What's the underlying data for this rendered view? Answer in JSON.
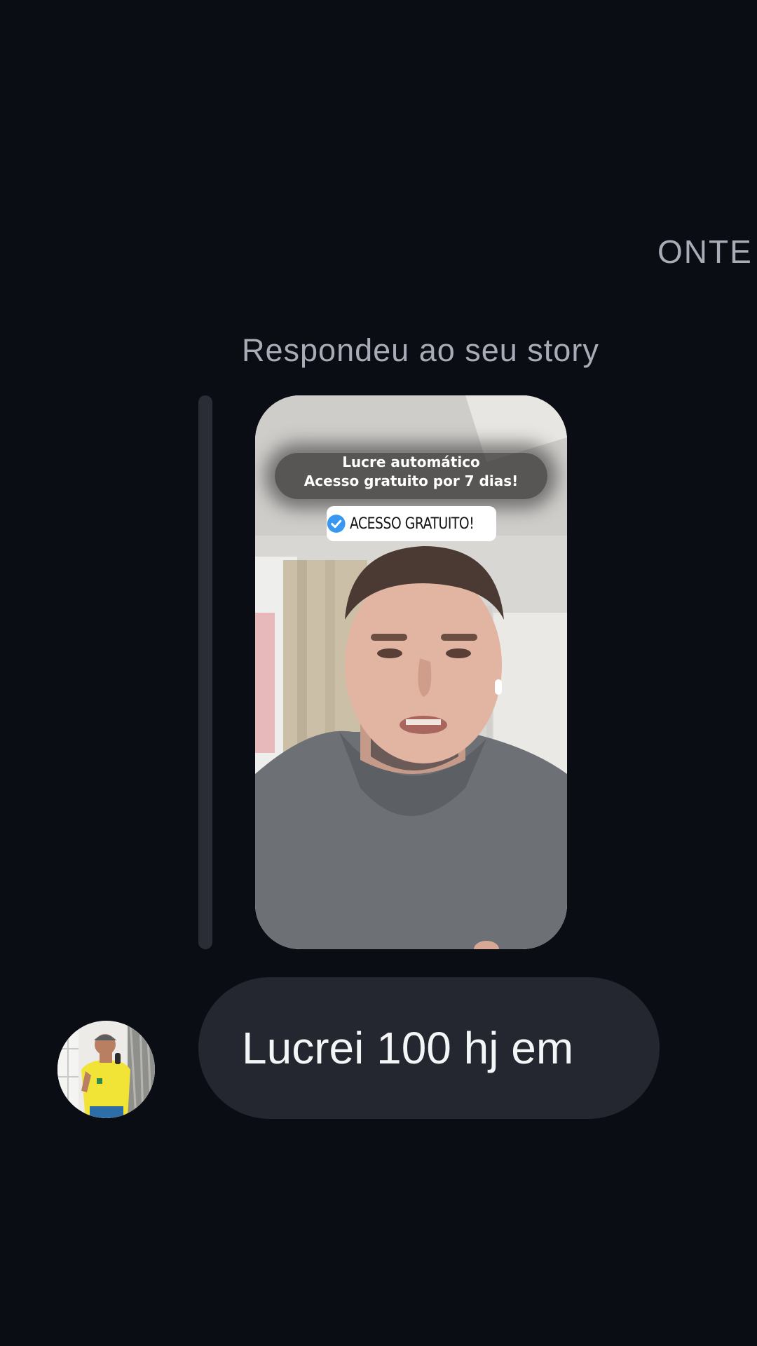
{
  "thread": {
    "date_separator": "ONTE",
    "reply_caption": "Respondeu ao seu story"
  },
  "story": {
    "caption_line1": "Lucre automático",
    "caption_line2": "Acesso gratuito por 7 dias!",
    "badge_text": "ACESSO GRATUITO!"
  },
  "message": {
    "text": "Lucrei 100 hj em"
  },
  "colors": {
    "background": "#0b0d14",
    "bubble": "#24272f",
    "secondary_text": "#a8acb6",
    "badge_check": "#3897f0"
  }
}
